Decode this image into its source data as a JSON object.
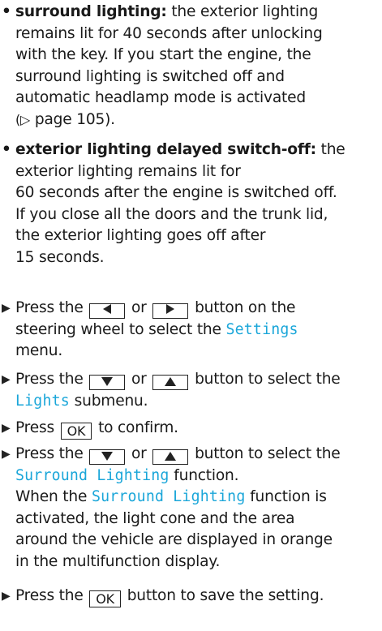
{
  "bullets": [
    {
      "term": "surround lighting:",
      "lines": [
        "the exterior lighting",
        "remains lit for 40 seconds after unlocking",
        "with the key. If you start the engine, the",
        "surround lighting is switched off and",
        "automatic headlamp mode is activated"
      ],
      "page_ref_symbol": "(▷",
      "page_ref_text": "page 105)."
    },
    {
      "term": "exterior lighting delayed switch-off:",
      "lines": [
        "the",
        "exterior lighting remains lit for",
        "60 seconds after the engine is switched off.",
        "If you close all the doors and the trunk lid,",
        "the exterior lighting goes off after",
        "15 seconds."
      ]
    }
  ],
  "steps": {
    "s1": {
      "pre": "Press the",
      "or": "or",
      "post": "button on the",
      "line2_pre": "steering wheel to select the",
      "display": "Settings",
      "line3": "menu.",
      "keys": [
        "left-arrow",
        "right-arrow"
      ]
    },
    "s2": {
      "pre": "Press the",
      "or": "or",
      "post": "button to select the",
      "display": "Lights",
      "line2_post": "submenu.",
      "keys": [
        "down-arrow",
        "up-arrow"
      ]
    },
    "s3": {
      "pre": "Press",
      "key": "OK",
      "post": "to confirm."
    },
    "s4": {
      "pre": "Press the",
      "or": "or",
      "post": "button to select the",
      "display": "Surround Lighting",
      "line2_post": "function.",
      "result_pre": "When the",
      "result_display": "Surround Lighting",
      "result_post": "function is",
      "result_lines": [
        "activated, the light cone and the area",
        "around the vehicle are displayed in orange",
        "in the multifunction display."
      ],
      "keys": [
        "down-arrow",
        "up-arrow"
      ]
    },
    "s5": {
      "pre": "Press the",
      "key": "OK",
      "post": "button to save the setting."
    }
  },
  "symbols": {
    "bullet": "•",
    "step_arrow": "▶"
  },
  "colors": {
    "display_text": "#1aa6d9",
    "body_text": "#1a1a1a"
  }
}
